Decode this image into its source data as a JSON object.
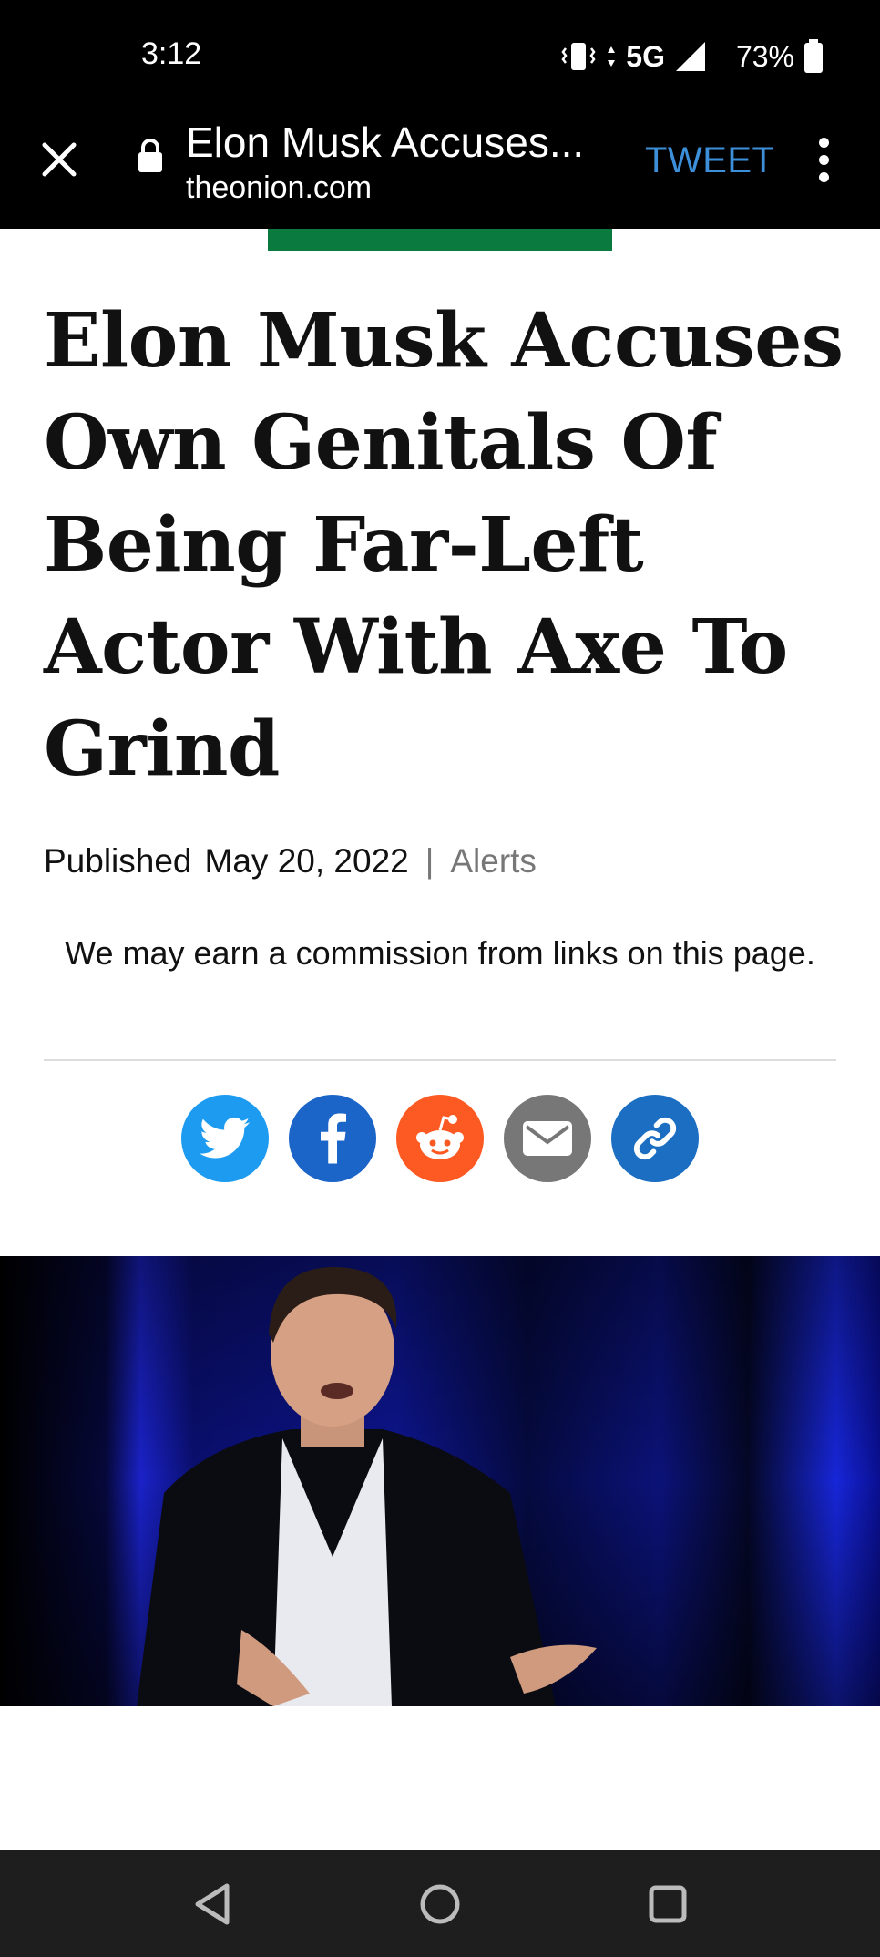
{
  "status_bar": {
    "time": "3:12",
    "network": "5G",
    "battery": "73%"
  },
  "toolbar": {
    "page_title": "Elon Musk Accuses...",
    "domain": "theonion.com",
    "tweet_label": "TWEET"
  },
  "article": {
    "headline": "Elon Musk Accuses Own Genitals Of Being Far-Left Actor With Axe To Grind",
    "published_label": "Published",
    "published_date": "May 20, 2022",
    "category": "Alerts",
    "disclaimer": "We may earn a commission from links on this page."
  },
  "share": {
    "icons": [
      "twitter-icon",
      "facebook-icon",
      "reddit-icon",
      "email-icon",
      "link-icon"
    ]
  },
  "colors": {
    "accent_green": "#0a7a3e",
    "tweet_blue": "#3c8fd8",
    "twitter": "#1d9bf0",
    "facebook": "#1b64c8",
    "reddit": "#fc5a22",
    "email": "#777777",
    "link": "#1b6ec2"
  }
}
